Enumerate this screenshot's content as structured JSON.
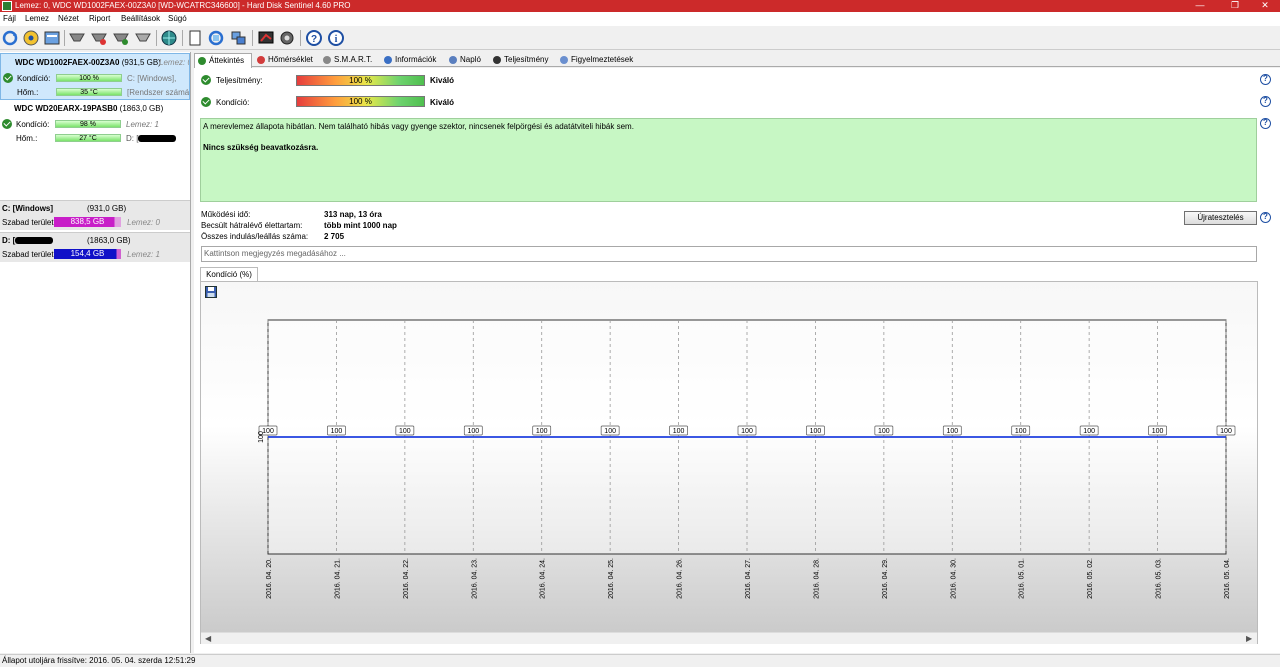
{
  "window": {
    "title": "Lemez: 0, WDC WD1002FAEX-00Z3A0 [WD-WCATRC346600]  -  Hard Disk Sentinel 4.60 PRO",
    "controls": [
      "—",
      "❐",
      "✕"
    ]
  },
  "menu": [
    "Fájl",
    "Lemez",
    "Nézet",
    "Riport",
    "Beállítások",
    "Súgó"
  ],
  "disks": [
    {
      "name": "WDC WD1002FAEX-00Z3A0",
      "size": "(931,5 GB)",
      "lemez": "Lemez: 0",
      "health_label": "Kondíció:",
      "health_value": "100 %",
      "health_pct": 100,
      "temp_label": "Hőm.:",
      "temp_value": "35 °C",
      "side1": "C: [Windows],",
      "side2": "[Rendszer számára fenntartott]"
    },
    {
      "name": "WDC WD20EARX-19PASB0",
      "size": "(1863,0 GB)",
      "health_label": "Kondíció:",
      "health_value": "98 %",
      "health_pct": 98,
      "temp_label": "Hőm.:",
      "temp_value": "27 °C",
      "side1": "Lemez: 1",
      "side2": "D: ["
    }
  ],
  "partitions": [
    {
      "name": "C: [Windows]",
      "size": "(931,0 GB)",
      "free_label": "Szabad terület",
      "free_value": "838,5 GB",
      "free_pct": 90,
      "lemez": "Lemez: 0",
      "color": "#c81ec8"
    },
    {
      "name": "D: [",
      "size": "(1863,0 GB)",
      "free_label": "Szabad terület",
      "free_value": "154,4 GB",
      "free_pct": 8,
      "lemez": "Lemez: 1",
      "color": "#1010c8"
    }
  ],
  "tabs": [
    {
      "label": "Áttekintés",
      "color": "#2e8b2e"
    },
    {
      "label": "Hőmérséklet",
      "color": "#d23c3c"
    },
    {
      "label": "S.M.A.R.T.",
      "color": "#888888"
    },
    {
      "label": "Információk",
      "color": "#3a6fc4"
    },
    {
      "label": "Napló",
      "color": "#5a7fbf"
    },
    {
      "label": "Teljesítmény",
      "color": "#333333"
    },
    {
      "label": "Figyelmeztetések",
      "color": "#6a8fcf"
    }
  ],
  "overview": {
    "performance_label": "Teljesítmény:",
    "performance_value": "100 %",
    "performance_rating": "Kiváló",
    "health_label": "Kondíció:",
    "health_value": "100 %",
    "health_rating": "Kiváló",
    "status_text": "A merevlemez állapota hibátlan. Nem található hibás vagy gyenge szektor, nincsenek felpörgési és adatátviteli hibák sem.",
    "status_action": "Nincs szükség beavatkozásra.",
    "power_on_label": "Működési idő:",
    "power_on_value": "313 nap, 13 óra",
    "lifetime_label": "Becsült hátralévő élettartam:",
    "lifetime_value": "több mint 1000 nap",
    "starts_label": "Összes indulás/leállás száma:",
    "starts_value": "2 705",
    "reset_button": "Újratesztelés",
    "note_placeholder": "Kattintson megjegyzés megadásához ...",
    "help": "?"
  },
  "chart_tab": "Kondíció  (%)",
  "chart_data": {
    "type": "line",
    "x": [
      "2016. 04. 20.",
      "2016. 04. 21.",
      "2016. 04. 22.",
      "2016. 04. 23.",
      "2016. 04. 24.",
      "2016. 04. 25.",
      "2016. 04. 26.",
      "2016. 04. 27.",
      "2016. 04. 28.",
      "2016. 04. 29.",
      "2016. 04. 30.",
      "2016. 05. 01.",
      "2016. 05. 02.",
      "2016. 05. 03.",
      "2016. 05. 04."
    ],
    "values": [
      100,
      100,
      100,
      100,
      100,
      100,
      100,
      100,
      100,
      100,
      100,
      100,
      100,
      100,
      100
    ],
    "y_tick": "100",
    "series_color": "#1f3fdf"
  },
  "statusbar": "Állapot utoljára frissítve: 2016. 05. 04. szerda 12:51:29"
}
